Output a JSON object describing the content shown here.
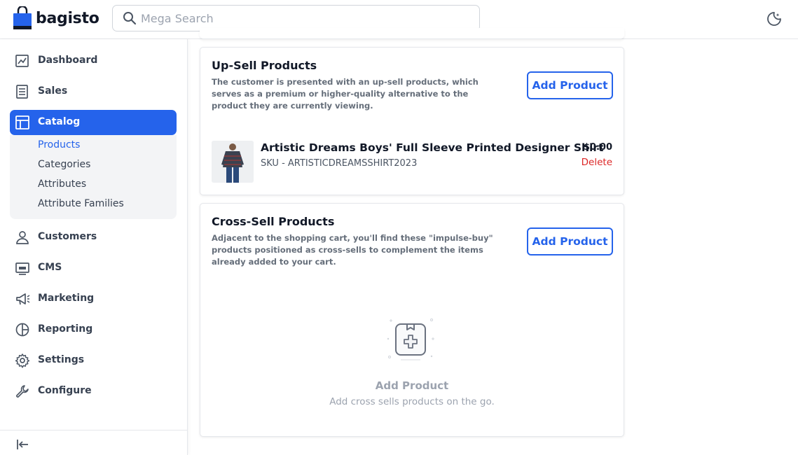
{
  "header": {
    "brand": "bagisto",
    "search_placeholder": "Mega Search",
    "theme_icon": "moon-icon"
  },
  "sidebar": {
    "items": [
      {
        "label": "Dashboard",
        "icon": "dashboard-icon"
      },
      {
        "label": "Sales",
        "icon": "sales-icon"
      },
      {
        "label": "Catalog",
        "icon": "catalog-icon",
        "active": true
      },
      {
        "label": "Customers",
        "icon": "customers-icon"
      },
      {
        "label": "CMS",
        "icon": "cms-icon"
      },
      {
        "label": "Marketing",
        "icon": "marketing-icon"
      },
      {
        "label": "Reporting",
        "icon": "reporting-icon"
      },
      {
        "label": "Settings",
        "icon": "settings-icon"
      },
      {
        "label": "Configure",
        "icon": "configure-icon"
      }
    ],
    "catalog_submenu": [
      {
        "label": "Products",
        "active": true
      },
      {
        "label": "Categories"
      },
      {
        "label": "Attributes"
      },
      {
        "label": "Attribute Families"
      }
    ],
    "collapse_icon": "collapse-sidebar-icon"
  },
  "upsell": {
    "title": "Up-Sell Products",
    "description": "The customer is presented with an up-sell products, which serves as a premium or higher-quality alternative to the product they are currently viewing.",
    "add_label": "Add Product",
    "product": {
      "name": "Artistic Dreams Boys' Full Sleeve Printed Designer Shirt",
      "sku": "SKU - ARTISTICDREAMSSHIRT2023",
      "price": "$0.00",
      "delete_label": "Delete"
    }
  },
  "crosssell": {
    "title": "Cross-Sell Products",
    "description": "Adjacent to the shopping cart, you'll find these \"impulse-buy\" products positioned as cross-sells to complement the items already added to your cart.",
    "add_label": "Add Product",
    "empty_title": "Add Product",
    "empty_subtitle": "Add cross sells products on the go."
  },
  "colors": {
    "accent": "#2563eb",
    "danger": "#dc2626",
    "muted": "#9ca3af"
  }
}
